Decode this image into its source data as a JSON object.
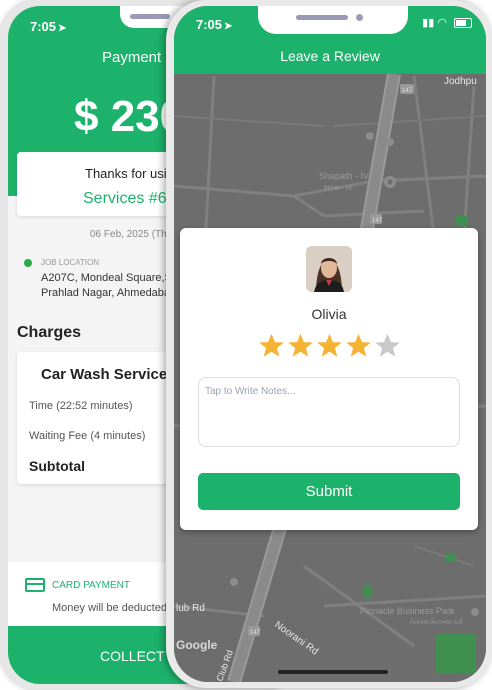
{
  "back_screen": {
    "status_time": "7:05",
    "title": "Payment S",
    "amount": "$ 230",
    "thanks_text": "Thanks for usin",
    "service_label": "Services #68",
    "date": "06 Feb, 2025 (Th",
    "job_location_label": "JOB LOCATION",
    "address_line1": "A207C, Mondeal Square,S",
    "address_line2": "Prahlad Nagar, Ahmedaba",
    "charges_heading": "Charges",
    "charges_service": "Car Wash Services -",
    "time_line": "Time (22:52 minutes)",
    "waiting_line": "Waiting Fee (4 minutes)",
    "subtotal_label": "Subtotal",
    "payment_method": "CARD PAYMENT",
    "payment_note": "Money will be deducted",
    "collect_button": "COLLECT P"
  },
  "front_screen": {
    "status_time": "7:05",
    "title": "Leave a Review",
    "map_labels": {
      "jodhpur": "Jodhpu",
      "shapath": "Shapath - IV",
      "shapath_sub": "શપથ - IV",
      "club_rd": "lub Rd",
      "noorani_rd": "Noorani Rd",
      "club_rd_vertical": "Club Rd",
      "pinnacle": "Pinnacle Business Park",
      "pinnacle_sub": "પિનેકલ બિઝનેસ પાર્ક",
      "route_147_a": "147",
      "route_147_b": "147",
      "route_147_c": "147",
      "google": "Google"
    },
    "reviewer_name": "Olivia",
    "rating": 4,
    "rating_max": 5,
    "notes_placeholder": "Tap to Write Notes...",
    "submit_label": "Submit"
  },
  "colors": {
    "brand_green": "#1db26b",
    "star_filled": "#f5b335",
    "star_empty": "#c9c9c9",
    "map_road": "#8a8a8a",
    "map_bg": "#6b6b6b"
  },
  "icons": [
    "location-arrow-icon",
    "signal-icon",
    "wifi-icon",
    "battery-icon",
    "credit-card-icon",
    "star-icon",
    "map-pin-icon"
  ]
}
